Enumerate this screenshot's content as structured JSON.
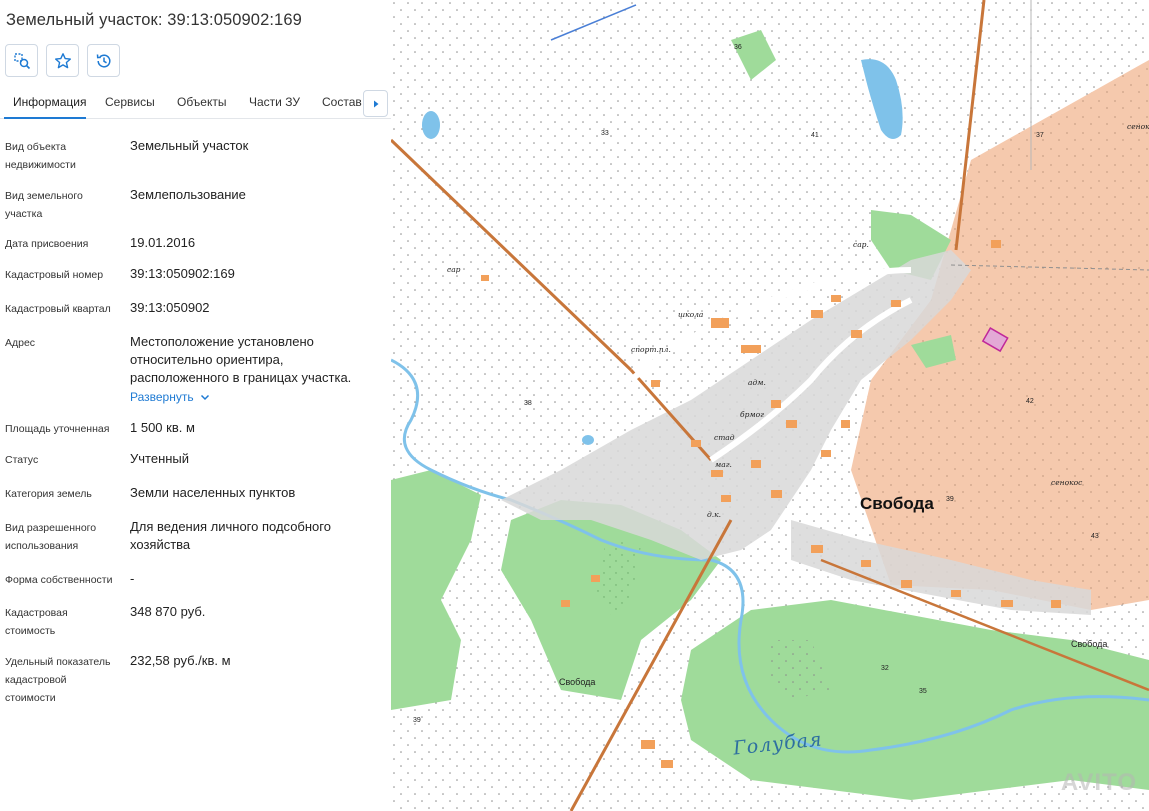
{
  "panel": {
    "title": "Земельный участок: 39:13:050902:169",
    "tools": [
      {
        "name": "locate-object",
        "icon": "locate-object-icon"
      },
      {
        "name": "favorite",
        "icon": "star-icon"
      },
      {
        "name": "history",
        "icon": "history-icon"
      }
    ],
    "tabs": [
      {
        "label": "Информация",
        "active": true
      },
      {
        "label": "Сервисы",
        "active": false
      },
      {
        "label": "Объекты",
        "active": false
      },
      {
        "label": "Части ЗУ",
        "active": false
      },
      {
        "label": "Состав",
        "active": false
      }
    ],
    "tab_next_icon": "chevron-right-icon",
    "accent_color": "#1e7ad3",
    "rows": [
      {
        "label": "Вид объекта недвижимости",
        "value": "Земельный участок"
      },
      {
        "label": "Вид земельного участка",
        "value": "Землепользование"
      },
      {
        "label": "Дата присвоения",
        "value": "19.01.2016"
      },
      {
        "label": "Кадастровый номер",
        "value": "39:13:050902:169"
      },
      {
        "label": "Кадастровый квартал",
        "value": "39:13:050902"
      },
      {
        "label": "Адрес",
        "value": "Местоположение установлено относительно ориентира, расположенного в границах участка."
      },
      {
        "label": "Площадь уточненная",
        "value": "1 500 кв. м"
      },
      {
        "label": "Статус",
        "value": "Учтенный"
      },
      {
        "label": "Категория земель",
        "value": "Земли населенных пунктов"
      },
      {
        "label": "Вид разрешенного использования",
        "value": "Для ведения личного подсобного хозяйства"
      },
      {
        "label": "Форма собственности",
        "value": "-"
      },
      {
        "label": "Кадастровая стоимость",
        "value": "348 870 руб."
      },
      {
        "label": "Удельный показатель кадастровой стоимости",
        "value": "232,58 руб./кв. м"
      }
    ],
    "expand_label": "Развернуть"
  },
  "map": {
    "labels": {
      "village": "Свобода",
      "river": "Голубая",
      "village_small_east": "Свобода",
      "village_small_west": "Свобода"
    },
    "numbers": [
      "36",
      "33",
      "41",
      "37",
      "38",
      "42",
      "39",
      "43",
      "32",
      "35",
      "39"
    ],
    "small_labels": [
      "сар.",
      "школа",
      "спорт.пл.",
      "адм.",
      "брмог",
      "стад",
      "маг.",
      "д.к.",
      "сар",
      "сенокос",
      "сенокос"
    ],
    "watermark": "AVITO",
    "colors": {
      "forest": "#9fdb9a",
      "farmland": "#f5c9ad",
      "water": "#7fc2ea",
      "road": "#c8763a",
      "building": "#f2a05a",
      "built_area": "#d8d8d8",
      "parcel_highlight": "#c0289a"
    }
  }
}
